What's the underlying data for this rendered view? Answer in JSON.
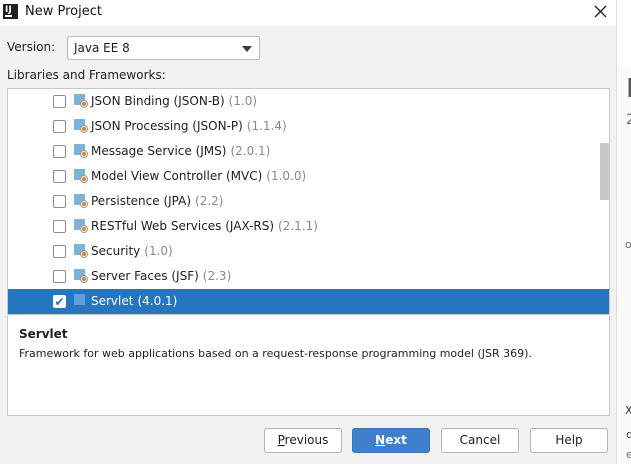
{
  "window": {
    "title": "New Project",
    "app_icon_text": "IJ"
  },
  "version": {
    "label": "Version:",
    "selected": "Java EE 8"
  },
  "libraries_label": "Libraries and Frameworks:",
  "frameworks": [
    {
      "name": "JSON Binding (JSON-B)",
      "version": "(1.0)",
      "checked": false,
      "selected": false
    },
    {
      "name": "JSON Processing (JSON-P)",
      "version": "(1.1.4)",
      "checked": false,
      "selected": false
    },
    {
      "name": "Message Service (JMS)",
      "version": "(2.0.1)",
      "checked": false,
      "selected": false
    },
    {
      "name": "Model View Controller (MVC)",
      "version": "(1.0.0)",
      "checked": false,
      "selected": false
    },
    {
      "name": "Persistence (JPA)",
      "version": "(2.2)",
      "checked": false,
      "selected": false
    },
    {
      "name": "RESTful Web Services (JAX-RS)",
      "version": "(2.1.1)",
      "checked": false,
      "selected": false
    },
    {
      "name": "Security",
      "version": "(1.0)",
      "checked": false,
      "selected": false
    },
    {
      "name": "Server Faces (JSF)",
      "version": "(2.3)",
      "checked": false,
      "selected": false
    },
    {
      "name": "Servlet",
      "version": "(4.0.1)",
      "checked": true,
      "selected": true
    }
  ],
  "description": {
    "title": "Servlet",
    "text": "Framework for web applications based on a request-response programming model (JSR 369)."
  },
  "buttons": {
    "previous": {
      "mnemonic": "P",
      "rest": "revious"
    },
    "next": {
      "mnemonic": "N",
      "rest": "ext"
    },
    "cancel": "Cancel",
    "help": "Help"
  },
  "background_fragments": [
    "E",
    "2",
    "or",
    "X",
    "d",
    "e"
  ],
  "colors": {
    "selection": "#2675bf",
    "primary_button": "#3f80cc",
    "framework_icon": "#7fb2d9"
  },
  "icons": {
    "close": "close-icon",
    "framework": "framework-icon",
    "app": "intellij-idea-icon",
    "dropdown": "chevron-down-icon"
  }
}
